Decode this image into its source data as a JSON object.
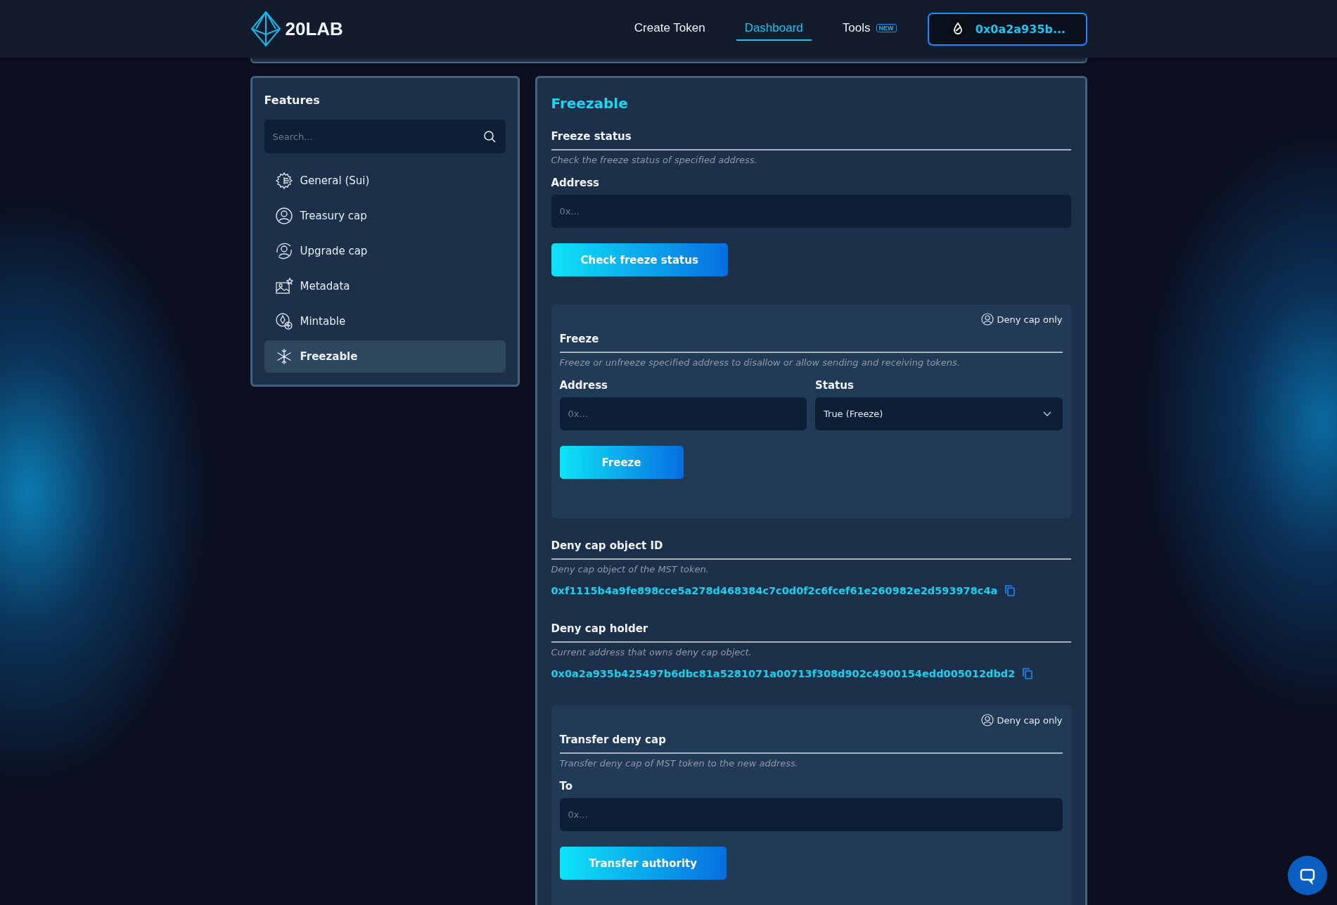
{
  "header": {
    "logo": "20LAB",
    "nav": [
      {
        "label": "Create Token",
        "selected": false
      },
      {
        "label": "Dashboard",
        "selected": true
      },
      {
        "label": "Tools",
        "selected": false,
        "badge": "NEW"
      }
    ],
    "wallet": "0x0a2a935b..."
  },
  "sidebar": {
    "title": "Features",
    "search": {
      "placeholder": "Search..."
    },
    "items": [
      {
        "label": "General (Sui)",
        "kind": "gear",
        "selected": false
      },
      {
        "label": "Treasury cap",
        "kind": "user",
        "selected": false
      },
      {
        "label": "Upgrade cap",
        "kind": "user-cycle",
        "selected": false
      },
      {
        "label": "Metadata",
        "kind": "image",
        "selected": false
      },
      {
        "label": "Mintable",
        "kind": "coin-plus",
        "selected": false
      },
      {
        "label": "Freezable",
        "kind": "snowflake",
        "selected": true
      }
    ]
  },
  "main": {
    "title": "Freezable",
    "sections": [
      {
        "kind": "form",
        "heading": "Freeze status",
        "description": "Check the freeze status of specified address.",
        "fields": [
          {
            "kind": "input",
            "label": "Address",
            "placeholder": "0x..."
          }
        ],
        "button": "Check freeze status"
      },
      {
        "kind": "card",
        "badge": "Deny cap only",
        "heading": "Freeze",
        "description": "Freeze or unfreeze specified address to disallow or allow sending and receiving tokens.",
        "fields": [
          {
            "kind": "input",
            "label": "Address",
            "placeholder": "0x..."
          },
          {
            "kind": "select",
            "label": "Status",
            "value": "True (Freeze)"
          }
        ],
        "button": "Freeze"
      },
      {
        "kind": "info",
        "heading": "Deny cap object ID",
        "description": "Deny cap object of the MST token.",
        "value": "0xf1115b4a9fe898cce5a278d468384c7c0d0f2c6fcef61e260982e2d593978c4a"
      },
      {
        "kind": "info",
        "heading": "Deny cap holder",
        "description": "Current address that owns deny cap object.",
        "value": "0x0a2a935b425497b6dbc81a5281071a00713f308d902c4900154edd005012dbd2"
      },
      {
        "kind": "card",
        "badge": "Deny cap only",
        "heading": "Transfer deny cap",
        "description": "Transfer deny cap of MST token to the new address.",
        "fields": [
          {
            "kind": "input",
            "label": "To",
            "placeholder": "0x..."
          }
        ],
        "button": "Transfer authority"
      }
    ]
  }
}
